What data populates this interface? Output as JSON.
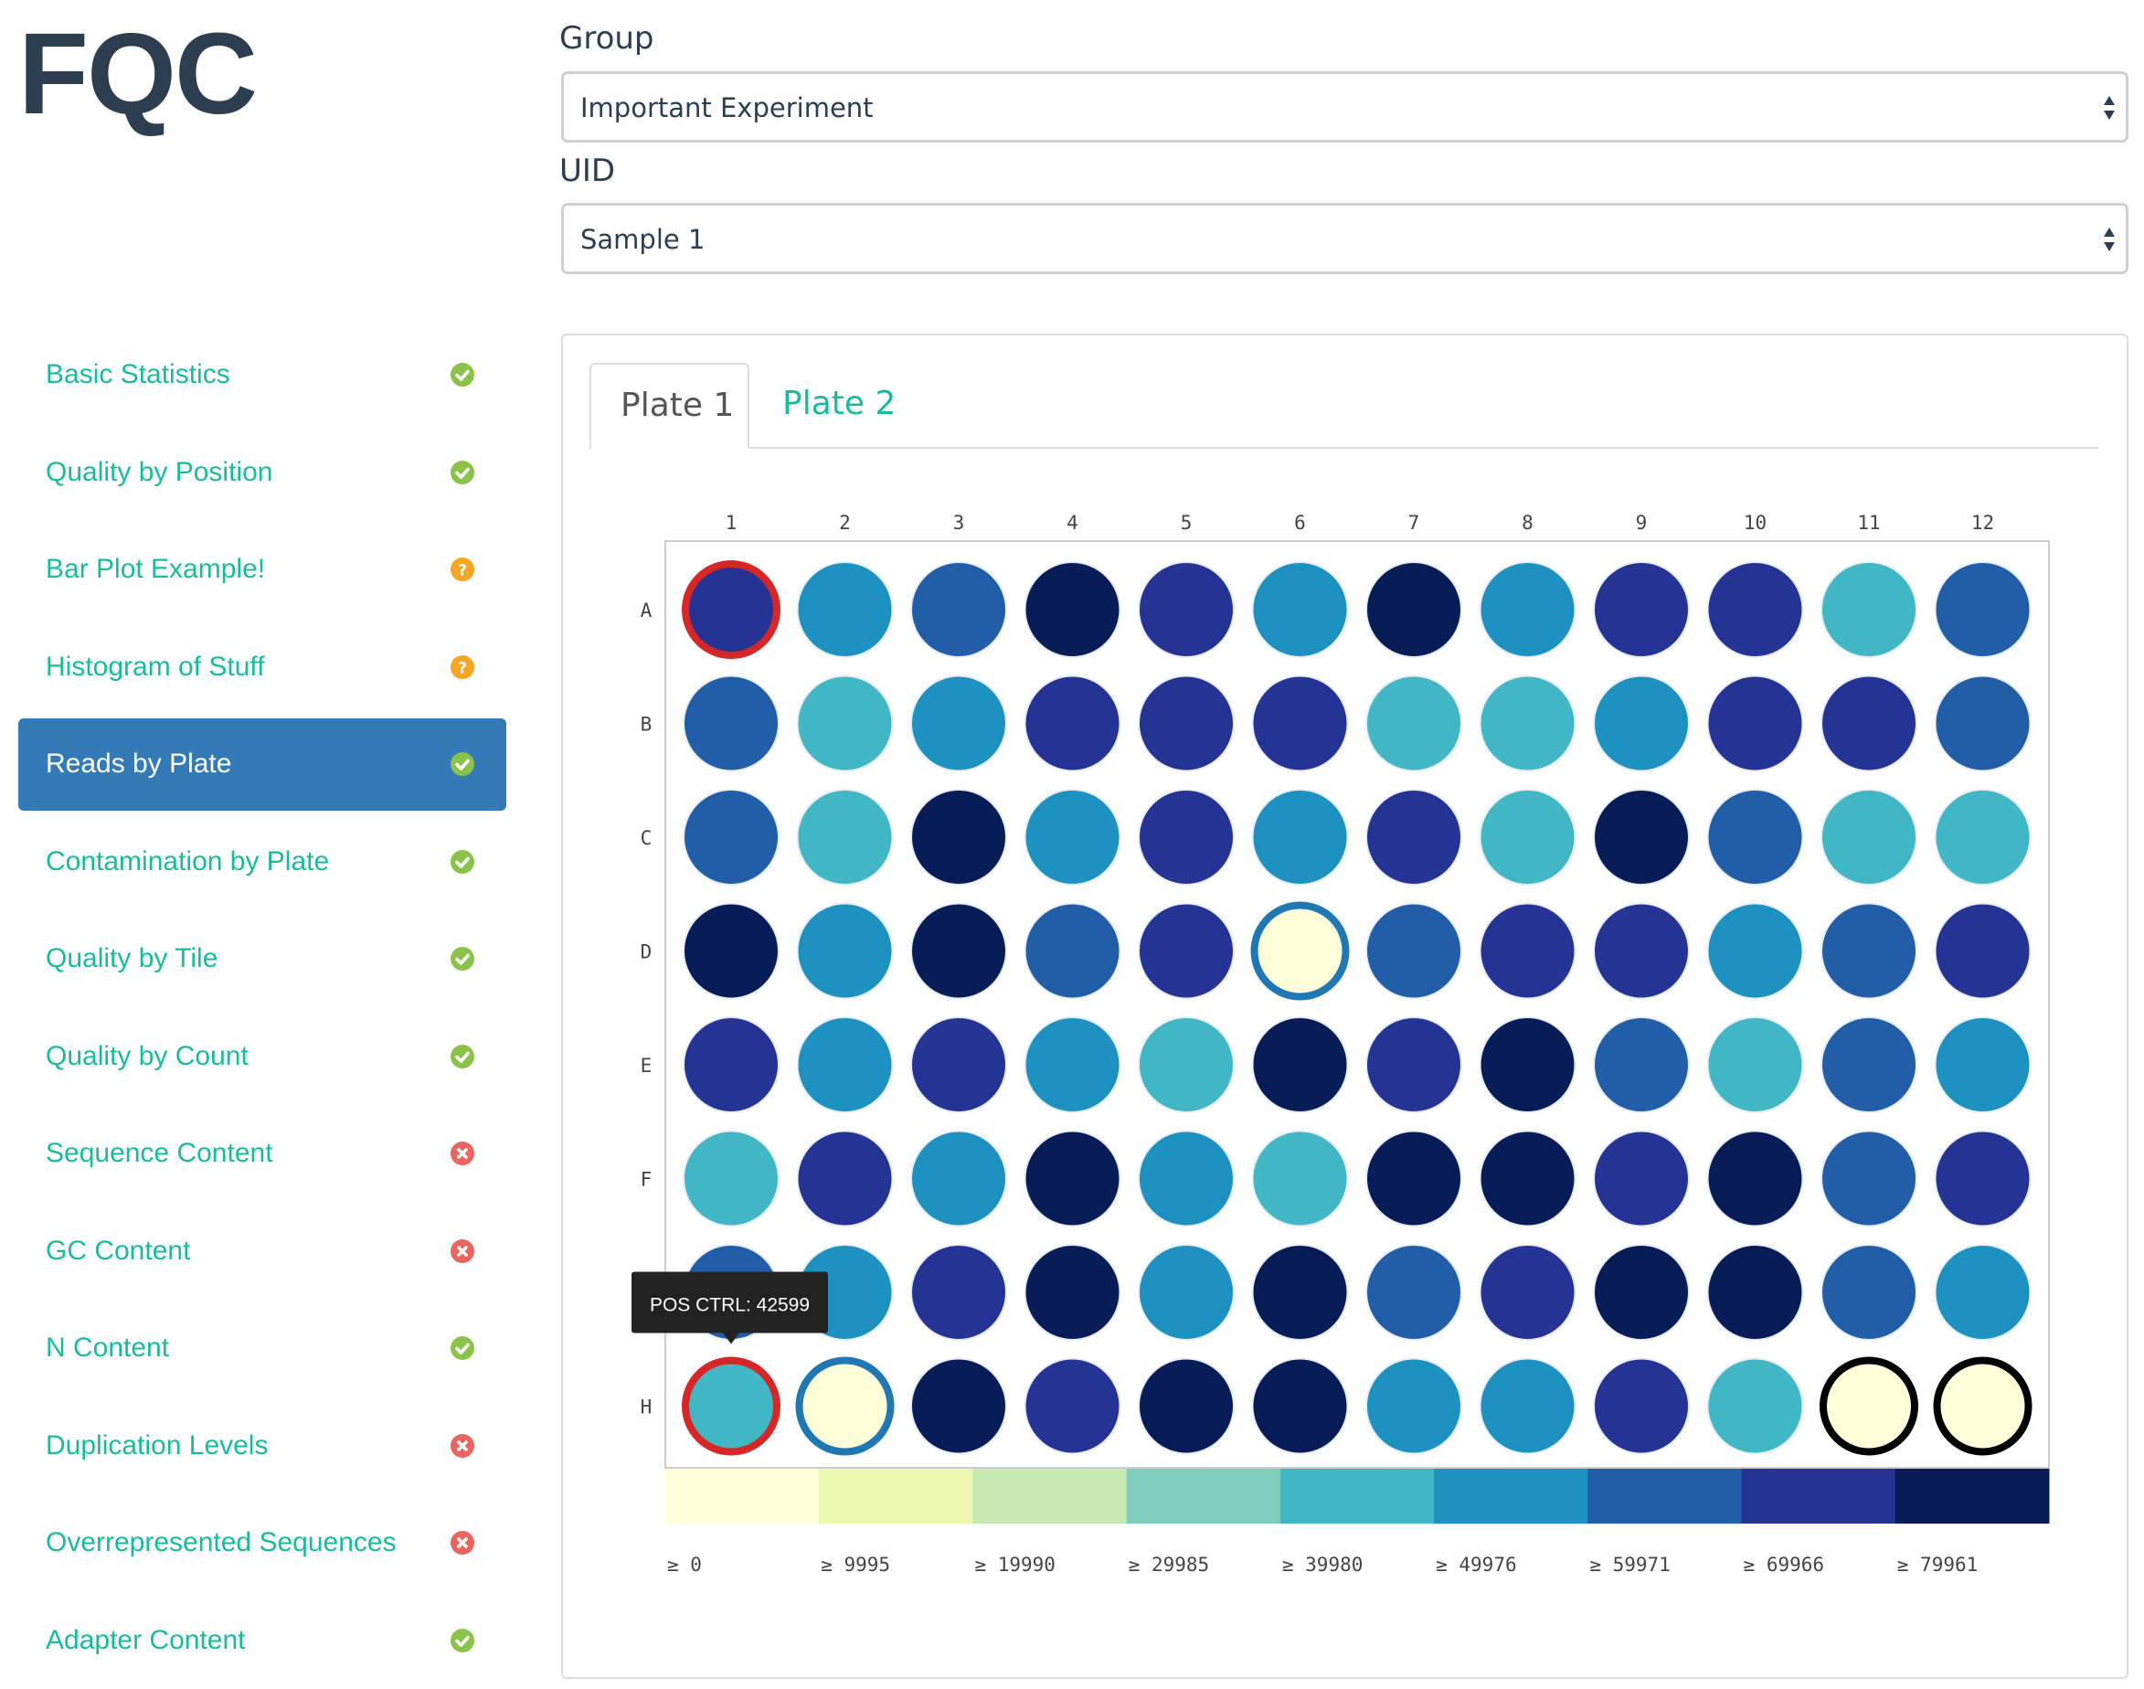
{
  "app": {
    "logo": "FQC"
  },
  "filters": {
    "group": {
      "label": "Group",
      "value": "Important Experiment"
    },
    "uid": {
      "label": "UID",
      "value": "Sample 1"
    }
  },
  "sidebar": {
    "items": [
      {
        "label": "Basic Statistics",
        "status": "pass",
        "active": false
      },
      {
        "label": "Quality by Position",
        "status": "pass",
        "active": false
      },
      {
        "label": "Bar Plot Example!",
        "status": "warn",
        "active": false
      },
      {
        "label": "Histogram of Stuff",
        "status": "warn",
        "active": false
      },
      {
        "label": "Reads by Plate",
        "status": "pass",
        "active": true
      },
      {
        "label": "Contamination by Plate",
        "status": "pass",
        "active": false
      },
      {
        "label": "Quality by Tile",
        "status": "pass",
        "active": false
      },
      {
        "label": "Quality by Count",
        "status": "pass",
        "active": false
      },
      {
        "label": "Sequence Content",
        "status": "fail",
        "active": false
      },
      {
        "label": "GC Content",
        "status": "fail",
        "active": false
      },
      {
        "label": "N Content",
        "status": "pass",
        "active": false
      },
      {
        "label": "Duplication Levels",
        "status": "fail",
        "active": false
      },
      {
        "label": "Overrepresented Sequences",
        "status": "fail",
        "active": false
      },
      {
        "label": "Adapter Content",
        "status": "pass",
        "active": false
      }
    ]
  },
  "tabs": [
    {
      "label": "Plate 1",
      "active": true
    },
    {
      "label": "Plate 2",
      "active": false
    }
  ],
  "status_colors": {
    "pass": "#8bc34a",
    "warn": "#f5a623",
    "fail": "#e8665f"
  },
  "plate": {
    "columns": [
      "1",
      "2",
      "3",
      "4",
      "5",
      "6",
      "7",
      "8",
      "9",
      "10",
      "11",
      "12"
    ],
    "rows": [
      "A",
      "B",
      "C",
      "D",
      "E",
      "F",
      "G",
      "H"
    ],
    "scale_colors": [
      "#ffffd9",
      "#edf8b1",
      "#c7e9b4",
      "#7fcdbb",
      "#41b6c4",
      "#1d91c0",
      "#225ea8",
      "#253494",
      "#081d58"
    ],
    "legend_labels": [
      "≥ 0",
      "≥ 9995",
      "≥ 19990",
      "≥ 29985",
      "≥ 39980",
      "≥ 49976",
      "≥ 59971",
      "≥ 69966",
      "≥ 79961"
    ],
    "well_levels": [
      [
        7,
        5,
        6,
        8,
        7,
        5,
        8,
        5,
        7,
        7,
        4,
        6
      ],
      [
        6,
        4,
        5,
        7,
        7,
        7,
        4,
        4,
        5,
        7,
        7,
        6
      ],
      [
        6,
        4,
        8,
        5,
        7,
        5,
        7,
        4,
        8,
        6,
        4,
        4
      ],
      [
        8,
        5,
        8,
        6,
        7,
        0,
        6,
        7,
        7,
        5,
        6,
        7
      ],
      [
        7,
        5,
        7,
        5,
        4,
        8,
        7,
        8,
        6,
        4,
        6,
        5
      ],
      [
        4,
        7,
        5,
        8,
        5,
        4,
        8,
        8,
        7,
        8,
        6,
        7
      ],
      [
        6,
        5,
        7,
        8,
        5,
        8,
        6,
        7,
        8,
        8,
        6,
        5
      ],
      [
        4,
        0,
        8,
        7,
        8,
        8,
        5,
        5,
        7,
        4,
        0,
        0
      ]
    ],
    "highlight_wells": [
      {
        "row": 0,
        "col": 0,
        "ring": "#d62728"
      },
      {
        "row": 3,
        "col": 5,
        "ring": "#1f77b4"
      },
      {
        "row": 7,
        "col": 0,
        "ring": "#d62728"
      },
      {
        "row": 7,
        "col": 1,
        "ring": "#1f77b4"
      },
      {
        "row": 7,
        "col": 10,
        "ring": "#000000"
      },
      {
        "row": 7,
        "col": 11,
        "ring": "#000000"
      }
    ],
    "tooltip": {
      "text": "POS CTRL: 42599",
      "row": 7,
      "col": 0
    }
  }
}
